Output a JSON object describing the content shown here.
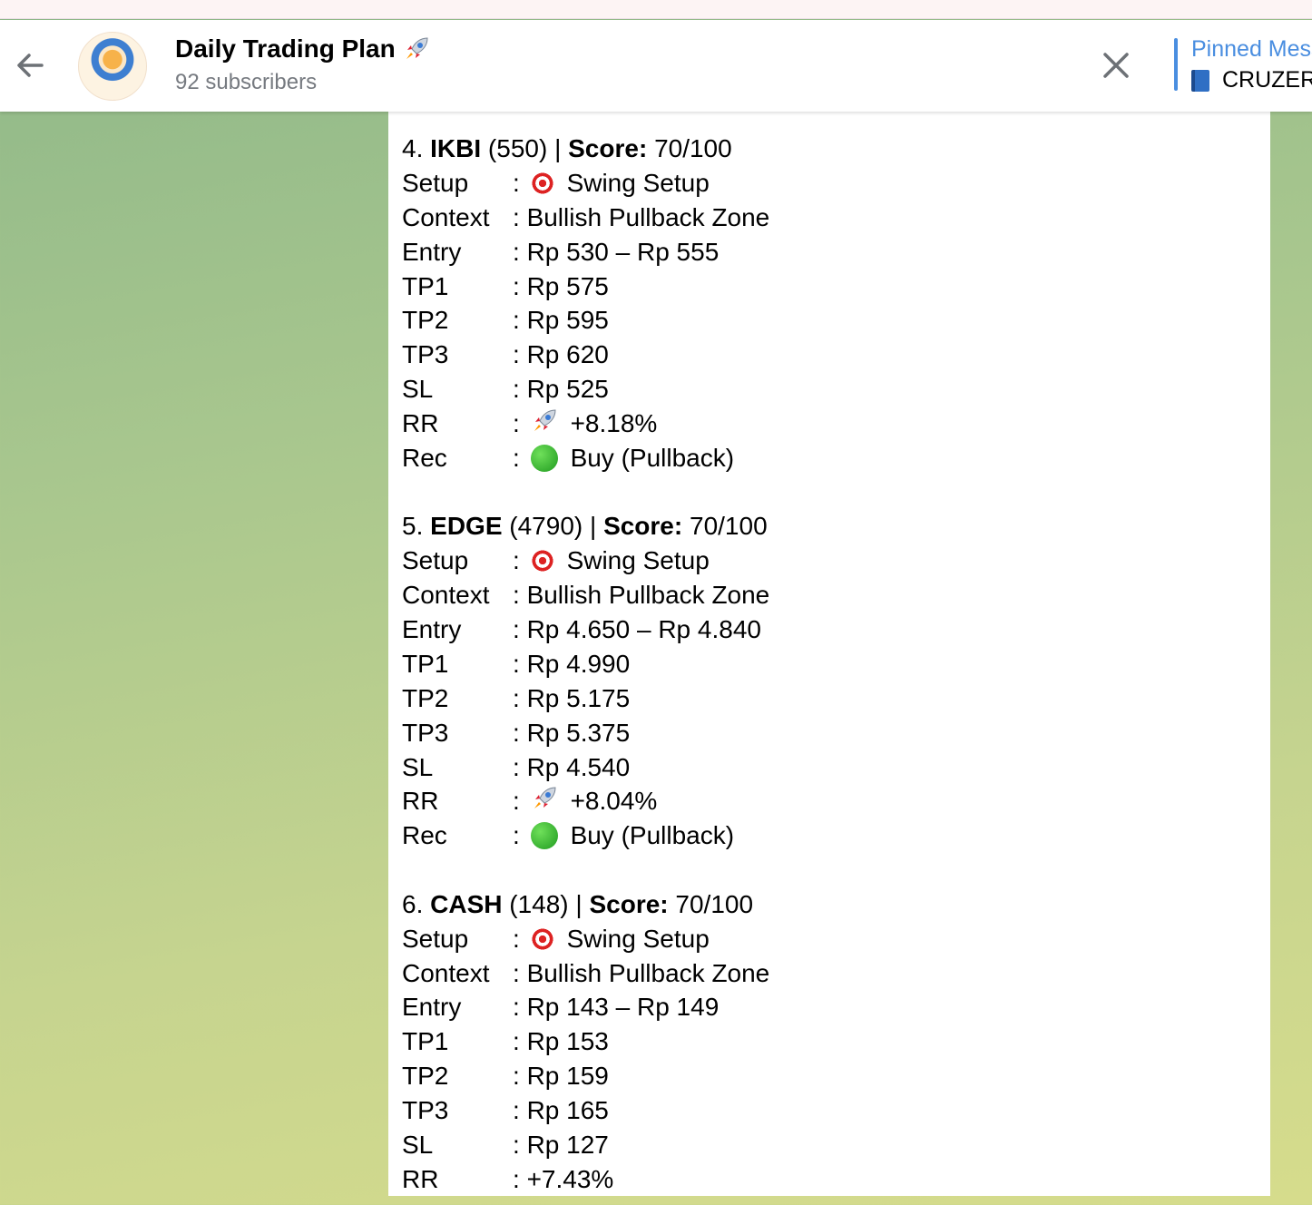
{
  "header": {
    "title": "Daily Trading Plan",
    "subscribers": "92 subscribers",
    "pinned_title": "Pinned Messages",
    "pinned_text": "CRUZER"
  },
  "entries": [
    {
      "num": "4.",
      "ticker": "IKBI",
      "price": "(550) |",
      "score_label": "Score:",
      "score": "70/100",
      "rows": [
        {
          "label": "Setup",
          "value": "Swing Setup",
          "icon": "target"
        },
        {
          "label": "Context",
          "value": "Bullish Pullback Zone"
        },
        {
          "label": "Entry",
          "value": "Rp 530 – Rp 555"
        },
        {
          "label": "TP1",
          "value": "Rp 575"
        },
        {
          "label": "TP2",
          "value": "Rp 595"
        },
        {
          "label": "TP3",
          "value": "Rp 620"
        },
        {
          "label": "SL",
          "value": "Rp 525"
        },
        {
          "label": "RR",
          "value": "+8.18%",
          "icon": "rocket"
        },
        {
          "label": "Rec",
          "value": "Buy (Pullback)",
          "icon": "green-circle"
        }
      ]
    },
    {
      "num": "5.",
      "ticker": "EDGE",
      "price": "(4790) |",
      "score_label": "Score:",
      "score": "70/100",
      "rows": [
        {
          "label": "Setup",
          "value": "Swing Setup",
          "icon": "target"
        },
        {
          "label": "Context",
          "value": "Bullish Pullback Zone"
        },
        {
          "label": "Entry",
          "value": "Rp 4.650 – Rp 4.840"
        },
        {
          "label": "TP1",
          "value": "Rp 4.990"
        },
        {
          "label": "TP2",
          "value": "Rp 5.175"
        },
        {
          "label": "TP3",
          "value": "Rp 5.375"
        },
        {
          "label": "SL",
          "value": "Rp 4.540"
        },
        {
          "label": "RR",
          "value": "+8.04%",
          "icon": "rocket"
        },
        {
          "label": "Rec",
          "value": "Buy (Pullback)",
          "icon": "green-circle"
        }
      ]
    },
    {
      "num": "6.",
      "ticker": "CASH",
      "price": "(148) |",
      "score_label": "Score:",
      "score": "70/100",
      "rows": [
        {
          "label": "Setup",
          "value": "Swing Setup",
          "icon": "target"
        },
        {
          "label": "Context",
          "value": "Bullish Pullback Zone"
        },
        {
          "label": "Entry",
          "value": "Rp 143 – Rp 149"
        },
        {
          "label": "TP1",
          "value": "Rp 153"
        },
        {
          "label": "TP2",
          "value": "Rp 159"
        },
        {
          "label": "TP3",
          "value": "Rp 165"
        },
        {
          "label": "SL",
          "value": "Rp 127"
        },
        {
          "label": "RR",
          "value": "+7.43%"
        }
      ]
    }
  ],
  "colors": {
    "accent": "#4a8ee0",
    "subtitle": "#767a80"
  }
}
